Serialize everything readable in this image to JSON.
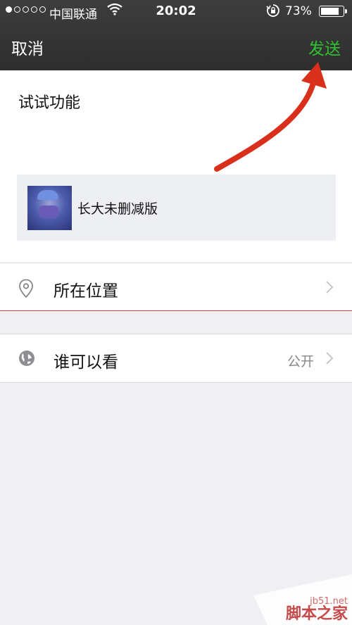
{
  "status_bar": {
    "carrier": "中国联通",
    "time": "20:02",
    "battery_percent": "73%",
    "battery_level": 0.73,
    "signal_dots": [
      true,
      false,
      false,
      false,
      false
    ]
  },
  "nav": {
    "cancel": "取消",
    "send": "发送",
    "send_color": "#2fc12f"
  },
  "compose": {
    "text": "试试功能",
    "shared_item": {
      "title": "长大未删减版",
      "thumbnail": "video-thumbnail"
    }
  },
  "rows": {
    "location": {
      "label": "所在位置",
      "icon": "location-pin-icon"
    },
    "visibility": {
      "label": "谁可以看",
      "value": "公开",
      "icon": "globe-icon"
    }
  },
  "annotation": {
    "arrow_color": "#d9301c"
  },
  "watermark": {
    "site": "jb51.net",
    "name": "脚本之家"
  }
}
